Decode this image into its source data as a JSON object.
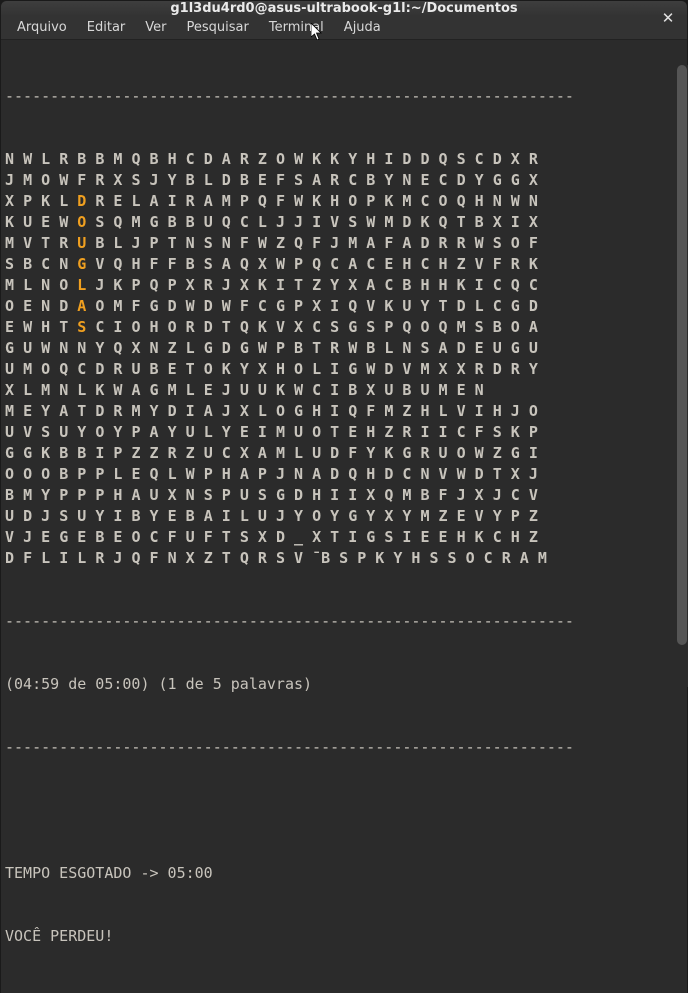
{
  "window": {
    "title": "g1l3du4rd0@asus-ultrabook-g1l:~/Documentos"
  },
  "menu": {
    "items": [
      "Arquivo",
      "Editar",
      "Ver",
      "Pesquisar",
      "Terminal",
      "Ajuda"
    ]
  },
  "terminal": {
    "dashes": "---------------------------------------------------------------",
    "grid": [
      "NWLRBBMQBHCDARZOWKKYHIDDQSCDXR",
      "JMOWFRXSJYBLDBEFSARCBYNECDYGGX",
      "XPKLDRELAIRAMPQFWKHOPKMCOQHNWN",
      "KUEWOSQMGBBUQCLJJIVSWMDKQTBXIX",
      "MVTRUBLJPTNSNFWZQFJMAFADRRWSOF",
      "SBCNGVQHFFBSAQXWPQCACEHCHZVFRK",
      "MLNOLJKPQPXRJXKITZYXACBHHKICQC",
      "OENDAOMFGDWDWFCGPXIQVKUYTDLCGD",
      "EWHTSCIOHORDTQKVXCSGSPQOQMSBOA",
      "GUWNNYQXNZLGDGWPBTRWBLNSADEUGU",
      "UMOQCDRUBETOKYXHOLIGWDVMXXRDRY",
      "XLMNLKWAGMLEJUUKWCIBXUBUMEN",
      "MEYATDRMYDIAJXLOGHIQFMZHLVIHJO",
      "UVSUYOYPAYULYEIMUOTEHZRIICFSKP",
      "GGKBBIPZZRZUCXAMLUDFYKGRUOWZGI",
      "OOOBPPLEQLWPHAPJNADQHDCNVWDTXJ",
      "BMYPPPHAUXNSPUSGDHIIXQMBFJXJCV",
      "UDJSUYIBYEBAILUJYOYGYXYMZEVYPZ",
      "VJEGEBEOCFUFTSXD_XTIGSIEEHKCHZ",
      "DFLILRJQFNXZTQRSV̄BSPKYHSSOCRAM"
    ],
    "highlights": [
      {
        "row": 2,
        "col": 4,
        "ch": "D"
      },
      {
        "row": 3,
        "col": 4,
        "ch": "O"
      },
      {
        "row": 4,
        "col": 4,
        "ch": "U"
      },
      {
        "row": 5,
        "col": 4,
        "ch": "G"
      },
      {
        "row": 6,
        "col": 4,
        "ch": "L"
      },
      {
        "row": 7,
        "col": 4,
        "ch": "A"
      },
      {
        "row": 8,
        "col": 4,
        "ch": "S"
      }
    ],
    "status": "(04:59 de 05:00) (1 de 5 palavras)",
    "end1": "TEMPO ESGOTADO -> 05:00",
    "end2": "VOCÊ PERDEU!"
  }
}
